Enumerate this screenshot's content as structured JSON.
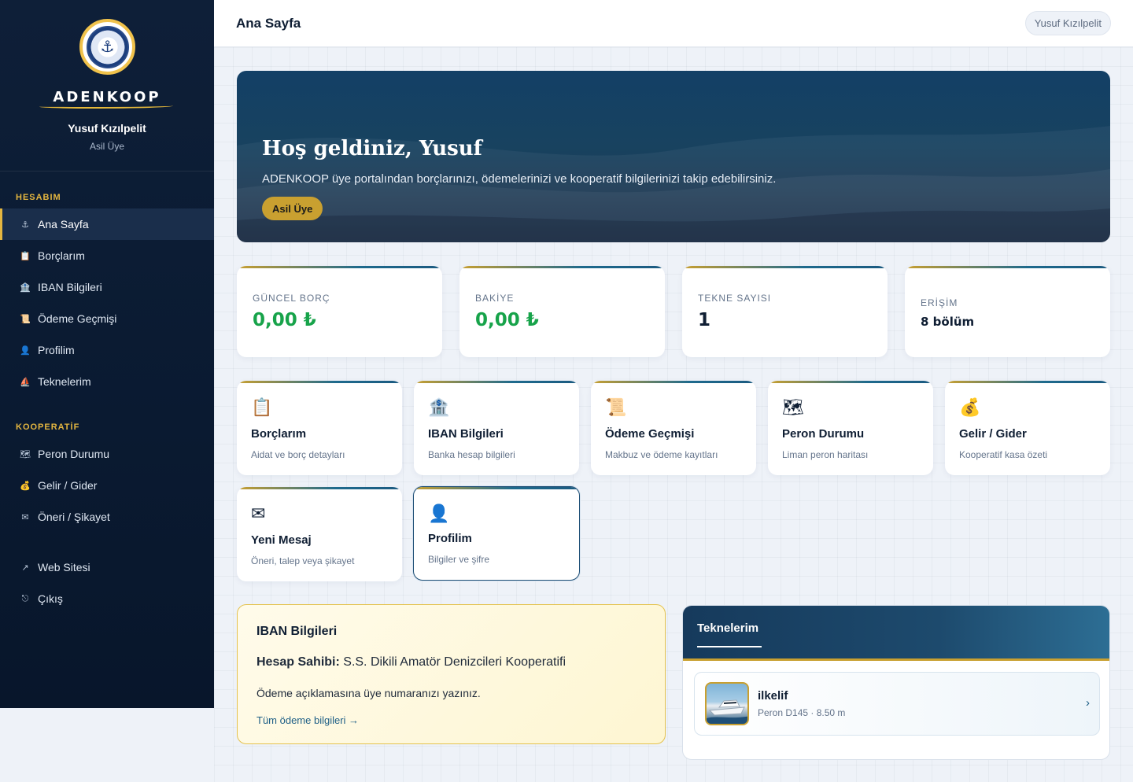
{
  "sidebar": {
    "brand_name": "ADENKOOP",
    "user_name": "Yusuf Kızılpelit",
    "user_role": "Asil Üye",
    "section_account": "HESABIM",
    "section_coop": "KOOPERATİF",
    "items": [
      {
        "label": "Ana Sayfa",
        "icon": "anchor-icon",
        "glyph": "⚓"
      },
      {
        "label": "Borçlarım",
        "icon": "clipboard-icon",
        "glyph": "📋"
      },
      {
        "label": "IBAN Bilgileri",
        "icon": "bank-icon",
        "glyph": "🏦"
      },
      {
        "label": "Ödeme Geçmişi",
        "icon": "scroll-icon",
        "glyph": "📜"
      },
      {
        "label": "Profilim",
        "icon": "user-icon",
        "glyph": "👤"
      },
      {
        "label": "Teknelerim",
        "icon": "sailboat-icon",
        "glyph": "⛵"
      },
      {
        "label": "Peron Durumu",
        "icon": "map-icon",
        "glyph": "🗺"
      },
      {
        "label": "Gelir / Gider",
        "icon": "money-bag-icon",
        "glyph": "💰"
      },
      {
        "label": "Öneri / Şikayet",
        "icon": "envelope-icon",
        "glyph": "✉"
      },
      {
        "label": "Web Sitesi",
        "icon": "external-link-icon",
        "glyph": "↗"
      },
      {
        "label": "Çıkış",
        "icon": "logout-icon",
        "glyph": "⎋"
      }
    ]
  },
  "topbar": {
    "title": "Ana Sayfa",
    "user_chip": "Yusuf Kızılpelit"
  },
  "hero": {
    "title": "Hoş geldiniz, Yusuf",
    "subtitle": "ADENKOOP üye portalından borçlarınızı, ödemelerinizi ve kooperatif bilgilerinizi takip edebilirsiniz.",
    "badge": "Asil Üye"
  },
  "stats": [
    {
      "label": "GÜNCEL BORÇ",
      "value": "0,00 ₺"
    },
    {
      "label": "BAKİYE",
      "value": "0,00 ₺"
    },
    {
      "label": "TEKNE SAYISI",
      "value": "1"
    },
    {
      "label": "ERİŞİM",
      "value": "8 bölüm"
    }
  ],
  "quick_links": [
    {
      "title": "Borçlarım",
      "subtitle": "Aidat ve borç detayları",
      "icon": "clipboard-icon",
      "glyph": "📋"
    },
    {
      "title": "IBAN Bilgileri",
      "subtitle": "Banka hesap bilgileri",
      "icon": "bank-icon",
      "glyph": "🏦"
    },
    {
      "title": "Ödeme Geçmişi",
      "subtitle": "Makbuz ve ödeme kayıtları",
      "icon": "scroll-icon",
      "glyph": "📜"
    },
    {
      "title": "Peron Durumu",
      "subtitle": "Liman peron haritası",
      "icon": "map-icon",
      "glyph": "🗺"
    },
    {
      "title": "Gelir / Gider",
      "subtitle": "Kooperatif kasa özeti",
      "icon": "money-bag-icon",
      "glyph": "💰"
    },
    {
      "title": "Yeni Mesaj",
      "subtitle": "Öneri, talep veya şikayet",
      "icon": "envelope-icon",
      "glyph": "✉"
    },
    {
      "title": "Profilim",
      "subtitle": "Bilgiler ve şifre",
      "icon": "user-icon",
      "glyph": "👤"
    }
  ],
  "iban": {
    "title": "IBAN Bilgileri",
    "holder_label": "Hesap Sahibi:",
    "holder_value": "S.S. Dikili Amatör Denizcileri Kooperatifi",
    "note": "Ödeme açıklamasına üye numaranızı yazınız.",
    "link": "Tüm ödeme bilgileri →"
  },
  "boats": {
    "title": "Teknelerim",
    "items": [
      {
        "name": "ilkelif",
        "detail": "Peron D145 · 8.50 m",
        "chevron": "›"
      }
    ]
  },
  "colors": {
    "sidebar_bg": "#0e1f38",
    "accent_gold": "#e4b640",
    "hero_blue": "#134066",
    "money_green": "#17a34a",
    "text_navy": "#0f1e33"
  }
}
